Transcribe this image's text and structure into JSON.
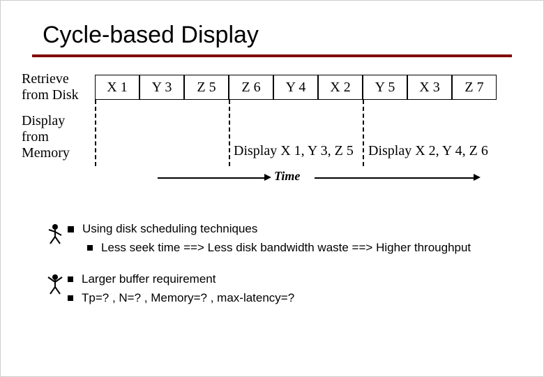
{
  "title": "Cycle-based Display",
  "labels": {
    "retrieve": "Retrieve from Disk",
    "display": "Display from Memory"
  },
  "blocks": [
    "X 1",
    "Y 3",
    "Z 5",
    "Z 6",
    "Y 4",
    "X 2",
    "Y 5",
    "X 3",
    "Z 7"
  ],
  "display_text_1": "Display X 1, Y 3, Z 5",
  "display_text_2": "Display X 2, Y 4, Z 6",
  "time_label": "Time",
  "bullets": {
    "main1": "Using disk scheduling techniques",
    "sub1": "Less seek time ==> Less disk bandwidth waste ==> Higher throughput",
    "sub2a": "Larger buffer requirement",
    "sub2b": "Tp=? , N=? , Memory=? , max-latency=?"
  }
}
